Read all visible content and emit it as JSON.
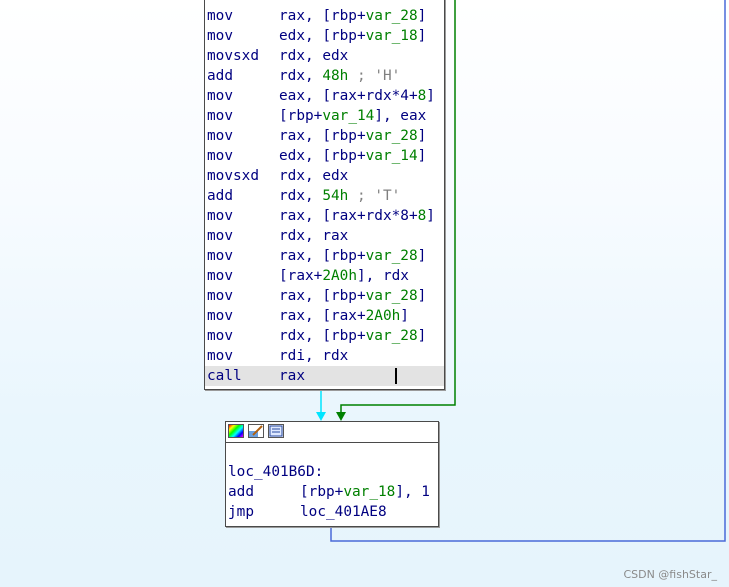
{
  "colors": {
    "mnemonic": "#000080",
    "variable": "#008000",
    "comment": "#808080",
    "edge_true": "#00e5ff",
    "edge_green": "#008000",
    "edge_blue": "#4a6ad8"
  },
  "node1": {
    "instructions": [
      {
        "mn": "mov",
        "op": [
          [
            "rax, [rbp+",
            "n"
          ],
          [
            "var_28",
            "g"
          ],
          [
            "]",
            "n"
          ]
        ]
      },
      {
        "mn": "mov",
        "op": [
          [
            "edx, [rbp+",
            "n"
          ],
          [
            "var_18",
            "g"
          ],
          [
            "]",
            "n"
          ]
        ]
      },
      {
        "mn": "movsxd",
        "op": [
          [
            "rdx, edx",
            "n"
          ]
        ]
      },
      {
        "mn": "add",
        "op": [
          [
            "rdx, ",
            "n"
          ],
          [
            "48h",
            "g"
          ],
          [
            " ; ",
            "c"
          ],
          [
            "'H'",
            "c"
          ]
        ]
      },
      {
        "mn": "mov",
        "op": [
          [
            "eax, [rax+rdx*4+",
            "n"
          ],
          [
            "8",
            "g"
          ],
          [
            "]",
            "n"
          ]
        ]
      },
      {
        "mn": "mov",
        "op": [
          [
            "[rbp+",
            "n"
          ],
          [
            "var_14",
            "g"
          ],
          [
            "], eax",
            "n"
          ]
        ]
      },
      {
        "mn": "mov",
        "op": [
          [
            "rax, [rbp+",
            "n"
          ],
          [
            "var_28",
            "g"
          ],
          [
            "]",
            "n"
          ]
        ]
      },
      {
        "mn": "mov",
        "op": [
          [
            "edx, [rbp+",
            "n"
          ],
          [
            "var_14",
            "g"
          ],
          [
            "]",
            "n"
          ]
        ]
      },
      {
        "mn": "movsxd",
        "op": [
          [
            "rdx, edx",
            "n"
          ]
        ]
      },
      {
        "mn": "add",
        "op": [
          [
            "rdx, ",
            "n"
          ],
          [
            "54h",
            "g"
          ],
          [
            " ; ",
            "c"
          ],
          [
            "'T'",
            "c"
          ]
        ]
      },
      {
        "mn": "mov",
        "op": [
          [
            "rax, [rax+rdx*8+",
            "n"
          ],
          [
            "8",
            "g"
          ],
          [
            "]",
            "n"
          ]
        ]
      },
      {
        "mn": "mov",
        "op": [
          [
            "rdx, rax",
            "n"
          ]
        ]
      },
      {
        "mn": "mov",
        "op": [
          [
            "rax, [rbp+",
            "n"
          ],
          [
            "var_28",
            "g"
          ],
          [
            "]",
            "n"
          ]
        ]
      },
      {
        "mn": "mov",
        "op": [
          [
            "[rax+",
            "n"
          ],
          [
            "2A0h",
            "g"
          ],
          [
            "], rdx",
            "n"
          ]
        ]
      },
      {
        "mn": "mov",
        "op": [
          [
            "rax, [rbp+",
            "n"
          ],
          [
            "var_28",
            "g"
          ],
          [
            "]",
            "n"
          ]
        ]
      },
      {
        "mn": "mov",
        "op": [
          [
            "rax, [rax+",
            "n"
          ],
          [
            "2A0h",
            "g"
          ],
          [
            "]",
            "n"
          ]
        ]
      },
      {
        "mn": "mov",
        "op": [
          [
            "rdx, [rbp+",
            "n"
          ],
          [
            "var_28",
            "g"
          ],
          [
            "]",
            "n"
          ]
        ]
      },
      {
        "mn": "mov",
        "op": [
          [
            "rdi, rdx",
            "n"
          ]
        ]
      },
      {
        "mn": "call",
        "op": [
          [
            "rax",
            "n"
          ]
        ],
        "highlight": true
      }
    ]
  },
  "node2": {
    "label": "loc_401B6D:",
    "instructions": [
      {
        "mn": "add",
        "op": [
          [
            "[rbp+",
            "n"
          ],
          [
            "var_18",
            "g"
          ],
          [
            "], 1",
            "n"
          ]
        ]
      },
      {
        "mn": "jmp",
        "op": [
          [
            "loc_401AE8",
            "n"
          ]
        ]
      }
    ],
    "header_icons": [
      "color-palette-icon",
      "edit-node-icon",
      "graph-node-icon"
    ]
  },
  "watermark": "CSDN @fishStar_"
}
